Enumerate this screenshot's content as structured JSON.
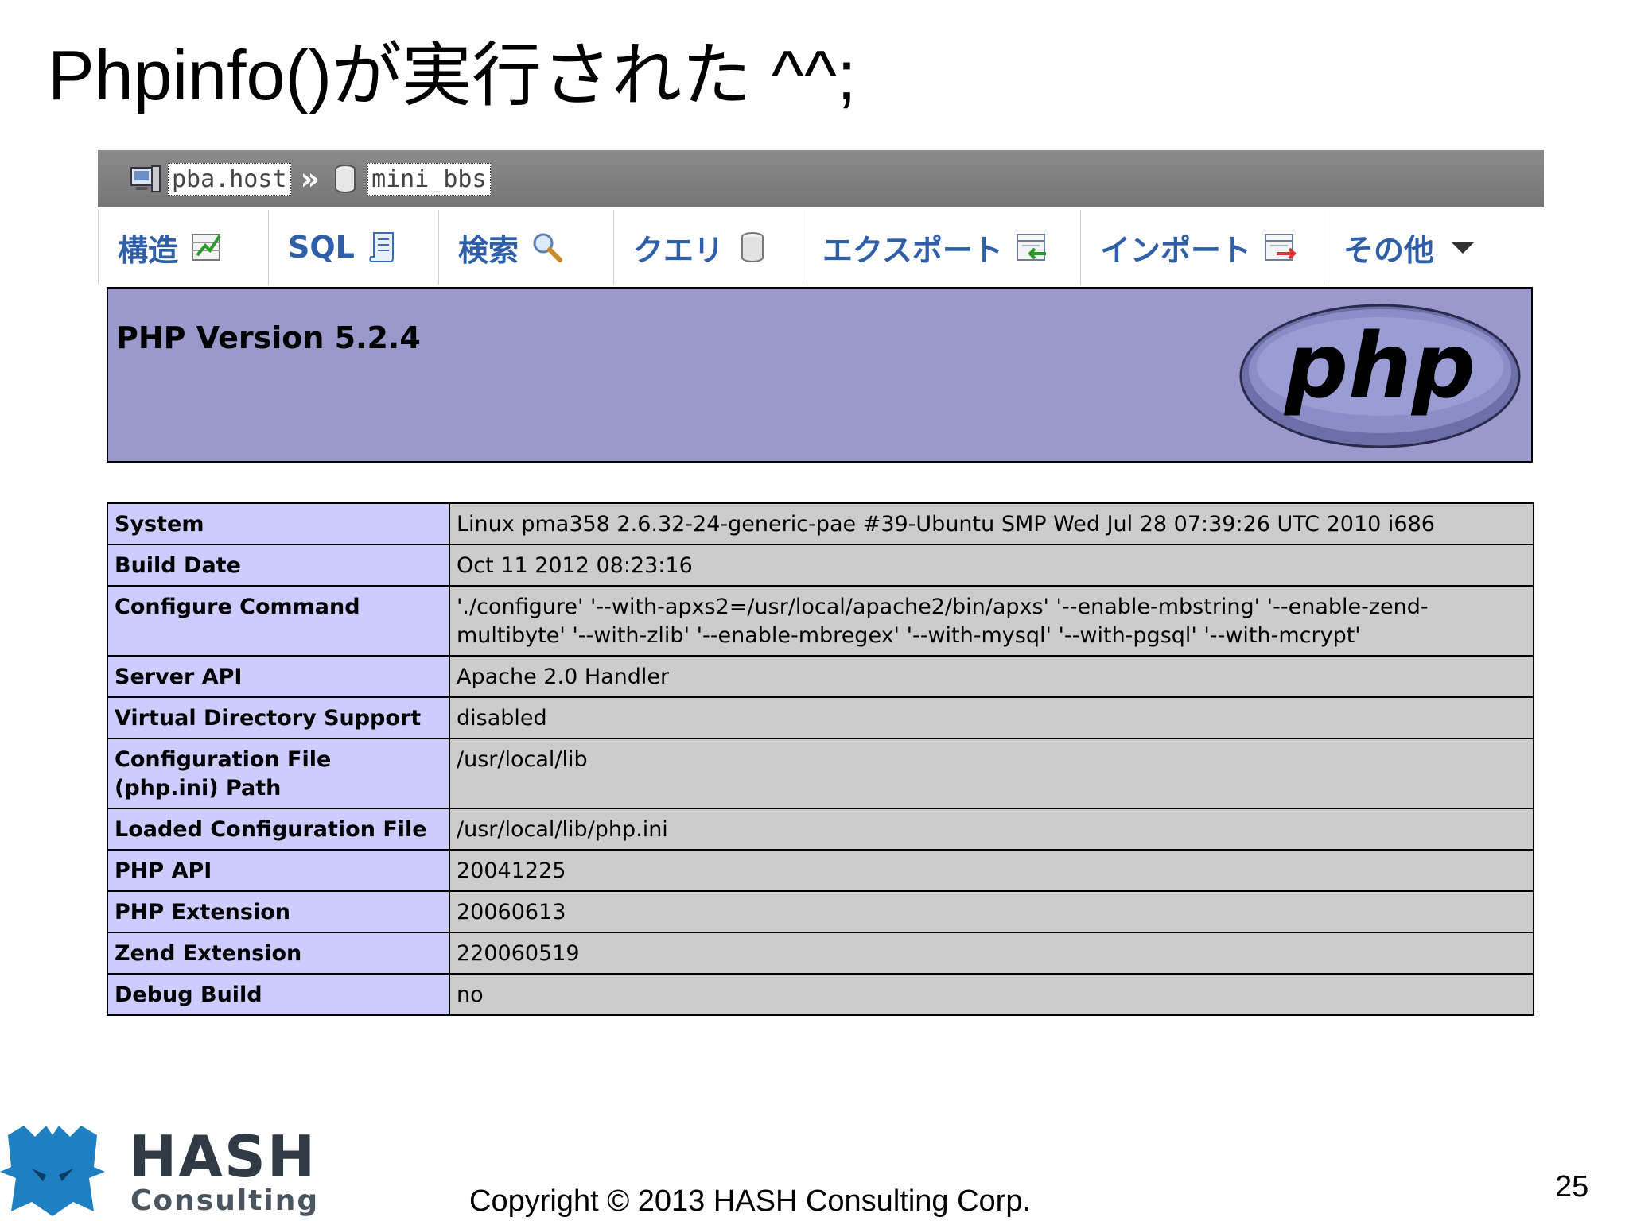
{
  "slide": {
    "title": "Phpinfo()が実行された ^^;",
    "copyright": "Copyright © 2013 HASH Consulting Corp.",
    "page_number": "25"
  },
  "logo": {
    "line1": "HASH",
    "line2": "Consulting"
  },
  "pma": {
    "breadcrumb": {
      "server": "pba.host",
      "database": "mini_bbs"
    },
    "tabs": [
      {
        "label": "構造",
        "icon": "structure-icon"
      },
      {
        "label": "SQL",
        "icon": "sql-icon"
      },
      {
        "label": "検索",
        "icon": "search-icon"
      },
      {
        "label": "クエリ",
        "icon": "query-icon"
      },
      {
        "label": "エクスポート",
        "icon": "export-icon"
      },
      {
        "label": "インポート",
        "icon": "import-icon"
      },
      {
        "label": "その他",
        "icon": "chevron-down-icon"
      }
    ]
  },
  "phpinfo": {
    "version": "PHP Version 5.2.4",
    "logo_text": "php",
    "rows": [
      {
        "key": "System",
        "value": "Linux pma358 2.6.32-24-generic-pae #39-Ubuntu SMP Wed Jul 28 07:39:26 UTC 2010 i686"
      },
      {
        "key": "Build Date",
        "value": "Oct 11 2012 08:23:16"
      },
      {
        "key": "Configure Command",
        "value": "'./configure' '--with-apxs2=/usr/local/apache2/bin/apxs' '--enable-mbstring' '--enable-zend-multibyte' '--with-zlib' '--enable-mbregex' '--with-mysql' '--with-pgsql' '--with-mcrypt'"
      },
      {
        "key": "Server API",
        "value": "Apache 2.0 Handler"
      },
      {
        "key": "Virtual Directory Support",
        "value": "disabled"
      },
      {
        "key": "Configuration File (php.ini) Path",
        "value": "/usr/local/lib"
      },
      {
        "key": "Loaded Configuration File",
        "value": "/usr/local/lib/php.ini"
      },
      {
        "key": "PHP API",
        "value": "20041225"
      },
      {
        "key": "PHP Extension",
        "value": "20060613"
      },
      {
        "key": "Zend Extension",
        "value": "220060519"
      },
      {
        "key": "Debug Build",
        "value": "no"
      }
    ]
  },
  "colors": {
    "header_bg": "#9999cc",
    "key_bg": "#ccccff",
    "value_bg": "#cccccc",
    "tab_text": "#2f5fa8",
    "breadcrumb_bg": "#808080",
    "logo_blue": "#1e7fc1"
  }
}
